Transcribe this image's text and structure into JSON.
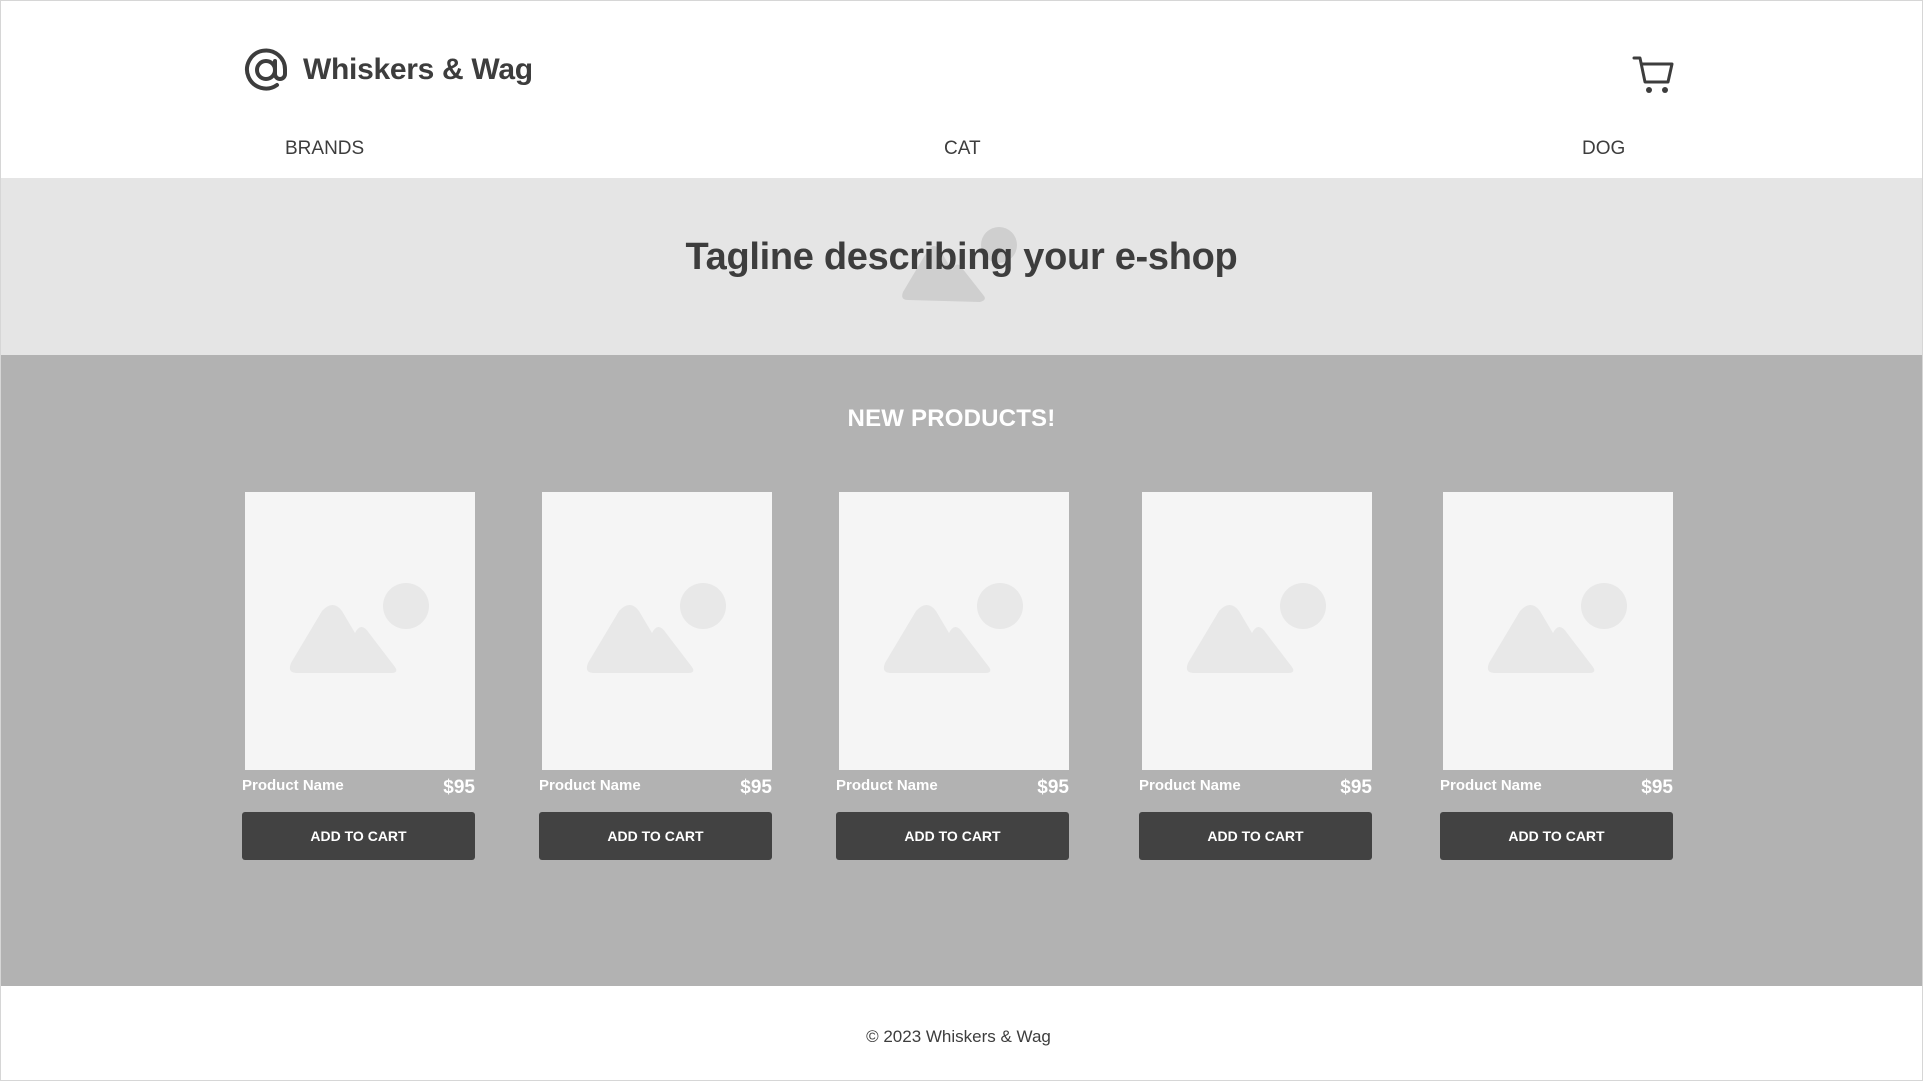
{
  "header": {
    "brand_name": "Whiskers & Wag",
    "logo_icon": "at-sign-icon",
    "cart_icon": "shopping-cart-icon",
    "nav": [
      {
        "label": "BRANDS"
      },
      {
        "label": "CAT"
      },
      {
        "label": "DOG"
      }
    ]
  },
  "hero": {
    "tagline": "Tagline describing your e-shop",
    "background_icon": "image-placeholder-icon"
  },
  "products": {
    "title": "NEW PRODUCTS!",
    "items": [
      {
        "name": "Product Name",
        "price": "$95",
        "button": "ADD TO CART",
        "image_icon": "image-placeholder-icon"
      },
      {
        "name": "Product Name",
        "price": "$95",
        "button": "ADD TO CART",
        "image_icon": "image-placeholder-icon"
      },
      {
        "name": "Product Name",
        "price": "$95",
        "button": "ADD TO CART",
        "image_icon": "image-placeholder-icon"
      },
      {
        "name": "Product Name",
        "price": "$95",
        "button": "ADD TO CART",
        "image_icon": "image-placeholder-icon"
      },
      {
        "name": "Product Name",
        "price": "$95",
        "button": "ADD TO CART",
        "image_icon": "image-placeholder-icon"
      }
    ]
  },
  "footer": {
    "copyright": "© 2023 Whiskers & Wag"
  },
  "colors": {
    "text_dark": "#3d3d3d",
    "hero_bg": "#e5e5e5",
    "products_bg": "#b2b2b2",
    "card_bg": "#f5f5f5",
    "button_bg": "#424242",
    "placeholder_shape": "#e8e8e8"
  }
}
